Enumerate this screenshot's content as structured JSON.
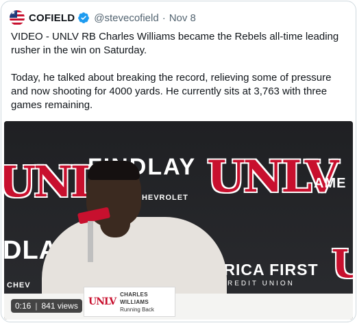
{
  "tweet": {
    "author_name": "COFIELD",
    "handle": "@stevecofield",
    "separator": "·",
    "date": "Nov 8",
    "paragraphs": [
      "VIDEO - UNLV RB Charles Williams  became the Rebels all-time leading rusher in the win on Saturday.",
      "Today, he talked about breaking the record, relieving some of pressure and now shooting for 4000 yards. He currently sits at 3,763 with three games remaining."
    ]
  },
  "video": {
    "time": "0:16",
    "views": "841 views",
    "backdrop": {
      "unlv_left": "UNLV",
      "unlv_right": "UNLV",
      "unlv_far_right": "U",
      "findlay_top": "FINDLAY",
      "chevrolet": "CHEVROLET",
      "findlay_bottom": "DLAY",
      "america_top": "AME",
      "america_first": "ERICA FIRST",
      "credit_union": "REDIT UNION",
      "chev_bottom": "CHEV"
    },
    "nameplate": {
      "logo": "UNLV",
      "name": "CHARLES WILLIAMS",
      "position": "Running Back"
    }
  },
  "colors": {
    "unlv_red": "#c8102e",
    "verified_blue": "#1d9bf0",
    "text_primary": "#0f1419",
    "text_secondary": "#536471"
  },
  "icons": {
    "avatar": "us-flag-avatar",
    "verified": "verified-badge-icon"
  }
}
